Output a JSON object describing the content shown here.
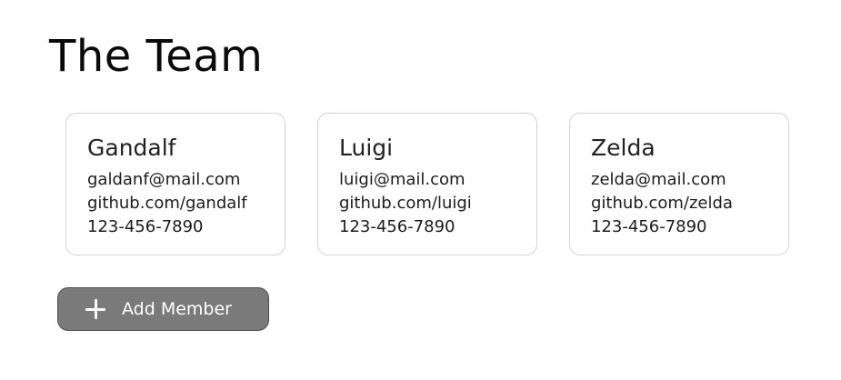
{
  "header": {
    "title": "The Team"
  },
  "members": [
    {
      "name": "Gandalf",
      "email": "galdanf@mail.com",
      "github": "github.com/gandalf",
      "phone": "123-456-7890"
    },
    {
      "name": "Luigi",
      "email": "luigi@mail.com",
      "github": "github.com/luigi",
      "phone": "123-456-7890"
    },
    {
      "name": "Zelda",
      "email": "zelda@mail.com",
      "github": "github.com/zelda",
      "phone": "123-456-7890"
    }
  ],
  "actions": {
    "add_member_label": "Add Member",
    "add_member_icon": "plus-icon"
  },
  "colors": {
    "button_fill": "#7a7a7a",
    "button_border": "#4e4e4e",
    "card_border": "#d4d4d4"
  }
}
